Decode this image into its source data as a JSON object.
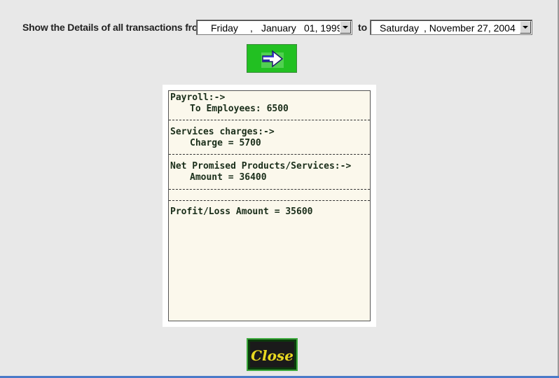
{
  "header": {
    "label": "Show the Details of all transactions from",
    "to_label": "to"
  },
  "from_date": {
    "weekday": "Friday",
    "comma": ",",
    "month": "January",
    "day_year": "01, 1999"
  },
  "to_date": {
    "weekday": "Saturday",
    "rest": ", November 27, 2004"
  },
  "go_button": {
    "icon": "arrow-right-icon"
  },
  "report": {
    "payroll_title": "Payroll:->",
    "payroll_line": "To Employees: 6500",
    "services_title": "Services charges:->",
    "services_line": "Charge = 5700",
    "net_title": "Net Promised Products/Services:->",
    "net_line": "Amount = 36400",
    "profit_line": "Profit/Loss Amount = 35600"
  },
  "close_button": {
    "label": "Close"
  },
  "colors": {
    "go_button_bg": "#22c022",
    "close_text": "#e8d820",
    "report_bg": "#fbf8ec"
  }
}
